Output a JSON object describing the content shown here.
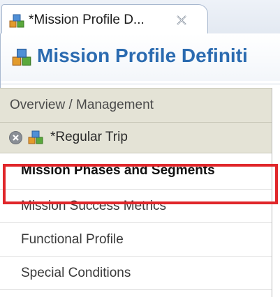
{
  "tab": {
    "title": "*Mission Profile D...",
    "icon": "mission-profile-icon",
    "close_icon": "close-x-icon"
  },
  "editor": {
    "title": "Mission Profile Definiti",
    "icon": "mission-profile-icon"
  },
  "nav": {
    "overview_label": "Overview / Management",
    "trip": {
      "label": "*Regular Trip",
      "close_icon": "remove-circle-icon",
      "icon": "mission-profile-icon"
    },
    "items": [
      {
        "label": "Mission Phases and Segments",
        "selected": true
      },
      {
        "label": "Mission Success Metrics",
        "selected": false
      },
      {
        "label": "Functional Profile",
        "selected": false
      },
      {
        "label": "Special Conditions",
        "selected": false
      }
    ]
  },
  "colors": {
    "title_blue": "#2b6bb0",
    "section_bg": "#e4e3d6",
    "highlight_red": "#e0262a"
  }
}
